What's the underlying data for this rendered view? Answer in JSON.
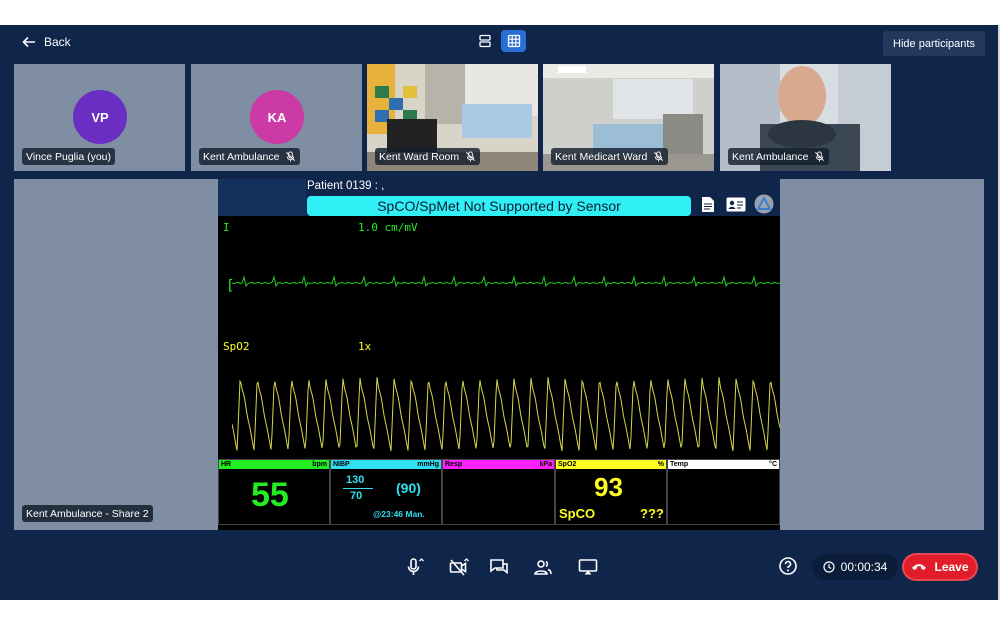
{
  "topbar": {
    "back_label": "Back",
    "hide_participants_label": "Hide participants"
  },
  "participants": [
    {
      "name": "Vince Puglia (you)",
      "initials": "VP",
      "avatar_color": "#6a2fc2",
      "muted": false
    },
    {
      "name": "Kent Ambulance",
      "initials": "KA",
      "avatar_color": "#cc3aa6",
      "muted": true
    },
    {
      "name": "Kent Ward Room",
      "initials": "",
      "muted": true
    },
    {
      "name": "Kent Medicart Ward",
      "initials": "",
      "muted": true
    },
    {
      "name": "Kent Ambulance",
      "initials": "",
      "muted": true
    }
  ],
  "share": {
    "label": "Kent Ambulance - Share 2"
  },
  "monitor": {
    "patient_line": "Patient 0139 : ,",
    "alarm_text": "SpCO/SpMet Not Supported by Sensor",
    "ecg": {
      "lead": "I",
      "scale": "1.0 cm/mV",
      "bracket": "["
    },
    "pleth": {
      "label": "SpO2",
      "gain": "1x"
    },
    "vitals": {
      "hr": {
        "title": "HR",
        "unit": "bpm",
        "value": "55"
      },
      "nibp": {
        "title": "NIBP",
        "unit": "mmHg",
        "systolic": "130",
        "diastolic": "70",
        "mean": "(90)",
        "time": "@23:46 Man."
      },
      "resp": {
        "title": "Resp",
        "unit": "kPa"
      },
      "spo2": {
        "title": "SpO2",
        "unit": "%",
        "value": "93",
        "spco_label": "SpCO",
        "spco_value": "???"
      },
      "temp": {
        "title": "Temp",
        "unit": "°C"
      }
    },
    "colors": {
      "hr": "#22ee22",
      "nibp": "#30e0f0",
      "resp": "#ff22ff",
      "spo2": "#ffff22",
      "temp": "#ffffff",
      "alarm": "#30f0f6"
    }
  },
  "controls": {
    "timer": "00:00:34",
    "leave_label": "Leave",
    "icons": [
      "microphone-icon",
      "camera-off-icon",
      "chat-icon",
      "participants-icon",
      "screen-share-icon",
      "help-icon"
    ]
  }
}
